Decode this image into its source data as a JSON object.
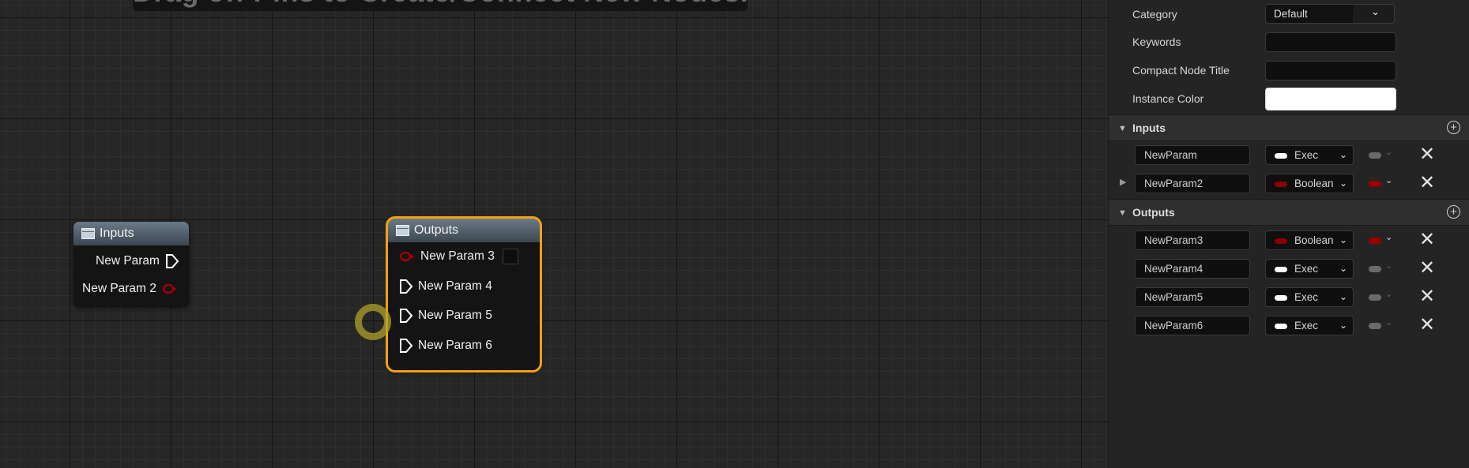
{
  "graph": {
    "banner_text": "Drag off Pins to Create/Connect New Nodes.",
    "inputs_node": {
      "title": "Inputs",
      "pins": [
        {
          "label": "New Param",
          "type": "exec"
        },
        {
          "label": "New Param 2",
          "type": "boolean"
        }
      ]
    },
    "outputs_node": {
      "title": "Outputs",
      "pins": [
        {
          "label": "New Param 3",
          "type": "boolean"
        },
        {
          "label": "New Param 4",
          "type": "exec"
        },
        {
          "label": "New Param 5",
          "type": "exec"
        },
        {
          "label": "New Param 6",
          "type": "exec"
        }
      ]
    }
  },
  "details": {
    "category": {
      "label": "Category",
      "value": "Default"
    },
    "keywords": {
      "label": "Keywords",
      "value": ""
    },
    "compact_title": {
      "label": "Compact Node Title",
      "value": ""
    },
    "instance_color": {
      "label": "Instance Color",
      "value": "#ffffff"
    },
    "inputs_section": {
      "title": "Inputs",
      "params": [
        {
          "name": "NewParam",
          "type": "Exec",
          "color": "#ffffff"
        },
        {
          "name": "NewParam2",
          "type": "Boolean",
          "color": "#8c0000"
        }
      ]
    },
    "outputs_section": {
      "title": "Outputs",
      "params": [
        {
          "name": "NewParam3",
          "type": "Boolean",
          "color": "#8c0000"
        },
        {
          "name": "NewParam4",
          "type": "Exec",
          "color": "#ffffff"
        },
        {
          "name": "NewParam5",
          "type": "Exec",
          "color": "#ffffff"
        },
        {
          "name": "NewParam6",
          "type": "Exec",
          "color": "#ffffff"
        }
      ]
    }
  },
  "colors": {
    "selection": "#f3a114",
    "boolean_pin": "#8c0000",
    "exec_pin": "#ffffff"
  }
}
